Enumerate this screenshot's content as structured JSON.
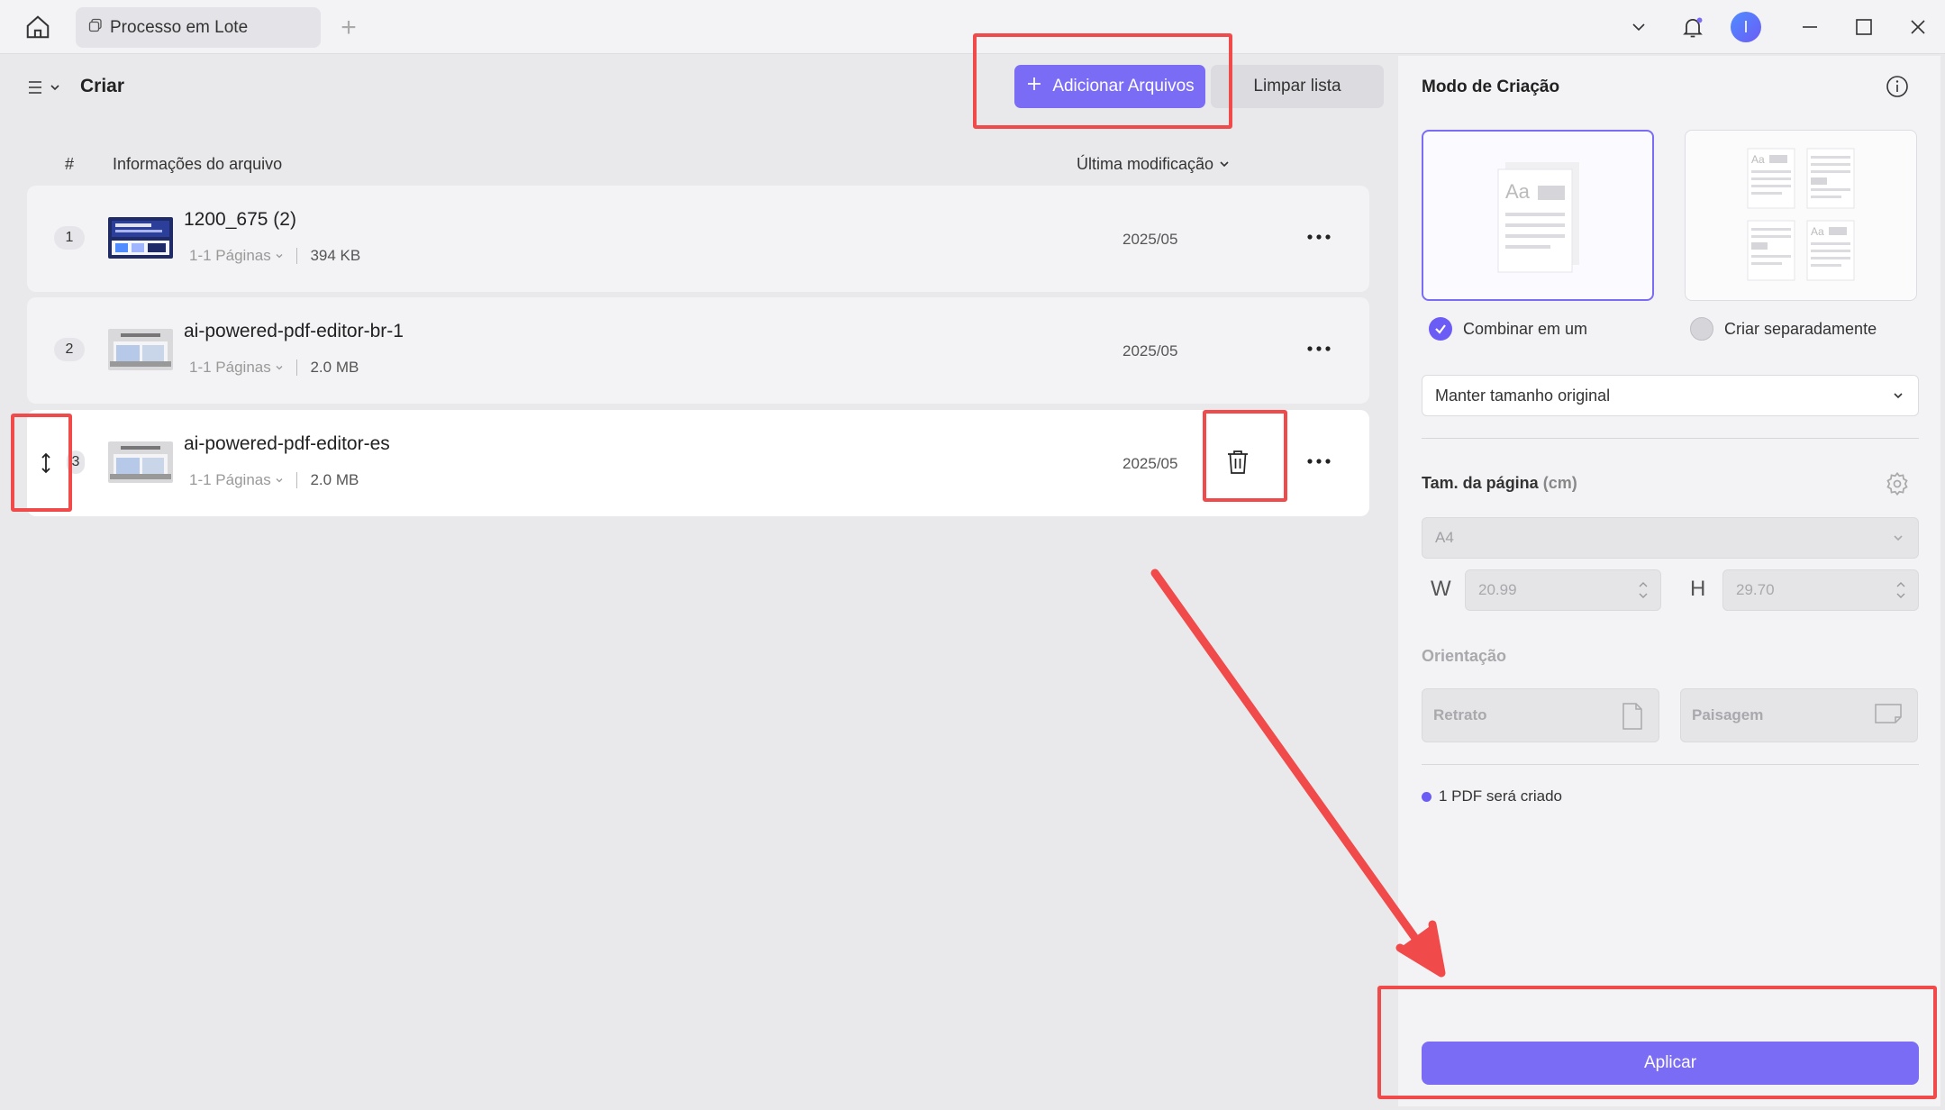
{
  "titlebar": {
    "tab_label": "Processo em Lote",
    "icons": [
      "home-icon",
      "tab-icon",
      "plus-icon",
      "chevron-down-icon",
      "bell-icon",
      "avatar",
      "minimize-icon",
      "maximize-icon",
      "close-icon"
    ],
    "avatar_letter": "I"
  },
  "toolbar": {
    "title": "Criar",
    "add_files_label": "Adicionar Arquivos",
    "clear_list_label": "Limpar lista"
  },
  "list_header": {
    "num": "#",
    "info": "Informações do arquivo",
    "modified": "Última modificação"
  },
  "files": [
    {
      "num": "1",
      "name": "1200_675 (2)",
      "pages": "1-1 Páginas",
      "size": "394 KB",
      "date": "2025/05"
    },
    {
      "num": "2",
      "name": "ai-powered-pdf-editor-br-1",
      "pages": "1-1 Páginas",
      "size": "2.0 MB",
      "date": "2025/05"
    },
    {
      "num": "3",
      "name": "ai-powered-pdf-editor-es",
      "pages": "1-1 Páginas",
      "size": "2.0 MB",
      "date": "2025/05"
    }
  ],
  "right_panel": {
    "title": "Modo de Criação",
    "combine_label": "Combinar em um",
    "separate_label": "Criar separadamente",
    "size_option": "Manter tamanho original",
    "page_size_label": "Tam. da página",
    "page_size_unit": "(cm)",
    "page_size_value": "A4",
    "w_label": "W",
    "w_value": "20.99",
    "h_label": "H",
    "h_value": "29.70",
    "orientation_label": "Orientação",
    "portrait_label": "Retrato",
    "landscape_label": "Paisagem",
    "note": "1 PDF será criado",
    "apply_label": "Aplicar"
  },
  "colors": {
    "accent": "#7b6cf6",
    "highlight": "#f14a4a"
  }
}
